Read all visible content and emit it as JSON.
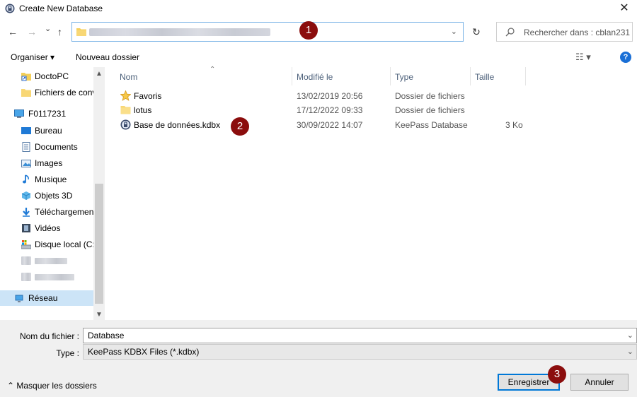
{
  "window": {
    "title": "Create New Database",
    "close_glyph": "✕"
  },
  "address": {
    "back_glyph": "←",
    "forward_glyph": "→",
    "history_glyph": "⌄",
    "up_glyph": "↑",
    "chevron_glyph": "⌄",
    "refresh_glyph": "↻",
    "search_placeholder": "Rechercher dans : cblan231"
  },
  "toolbar": {
    "organize_label": "Organiser ▾",
    "new_folder_label": "Nouveau dossier",
    "view_glyph": "☷ ▾",
    "help_glyph": "?"
  },
  "sidebar": {
    "items": [
      {
        "label": "DoctoPC",
        "icon": "shortcut-icon"
      },
      {
        "label": "Fichiers de conv",
        "icon": "folder-icon"
      },
      {
        "label": "F0117231",
        "icon": "computer-icon"
      },
      {
        "label": "Bureau",
        "icon": "desktop-icon"
      },
      {
        "label": "Documents",
        "icon": "documents-icon"
      },
      {
        "label": "Images",
        "icon": "images-icon"
      },
      {
        "label": "Musique",
        "icon": "music-icon"
      },
      {
        "label": "Objets 3D",
        "icon": "cube-icon"
      },
      {
        "label": "Téléchargements",
        "icon": "download-icon"
      },
      {
        "label": "Vidéos",
        "icon": "video-icon"
      },
      {
        "label": "Disque local (C:)",
        "icon": "drive-icon"
      },
      {
        "label": "Réseau",
        "icon": "network-icon"
      }
    ]
  },
  "columns": {
    "name": "Nom",
    "modified": "Modifié le",
    "type": "Type",
    "size": "Taille"
  },
  "files": [
    {
      "name": "Favoris",
      "modified": "13/02/2019 20:56",
      "type": "Dossier de fichiers",
      "size": "",
      "icon": "star-folder-icon"
    },
    {
      "name": "lotus",
      "modified": "17/12/2022 09:33",
      "type": "Dossier de fichiers",
      "size": "",
      "icon": "folder-icon"
    },
    {
      "name": "Base de données.kdbx",
      "modified": "30/09/2022 14:07",
      "type": "KeePass Database",
      "size": "3 Ko",
      "icon": "keepass-icon"
    }
  ],
  "badges": [
    "1",
    "2",
    "3"
  ],
  "form": {
    "filename_label": "Nom du fichier :",
    "filename_value": "Database",
    "type_label": "Type :",
    "type_value": "KeePass KDBX Files (*.kdbx)",
    "chevron_glyph": "⌄"
  },
  "footer": {
    "toggle_label": "⌃  Masquer les dossiers",
    "save_label": "Enregistrer",
    "cancel_label": "Annuler"
  },
  "colors": {
    "accent": "#0078d7",
    "badge": "#8b0d0d",
    "selected": "#cce4f7"
  }
}
